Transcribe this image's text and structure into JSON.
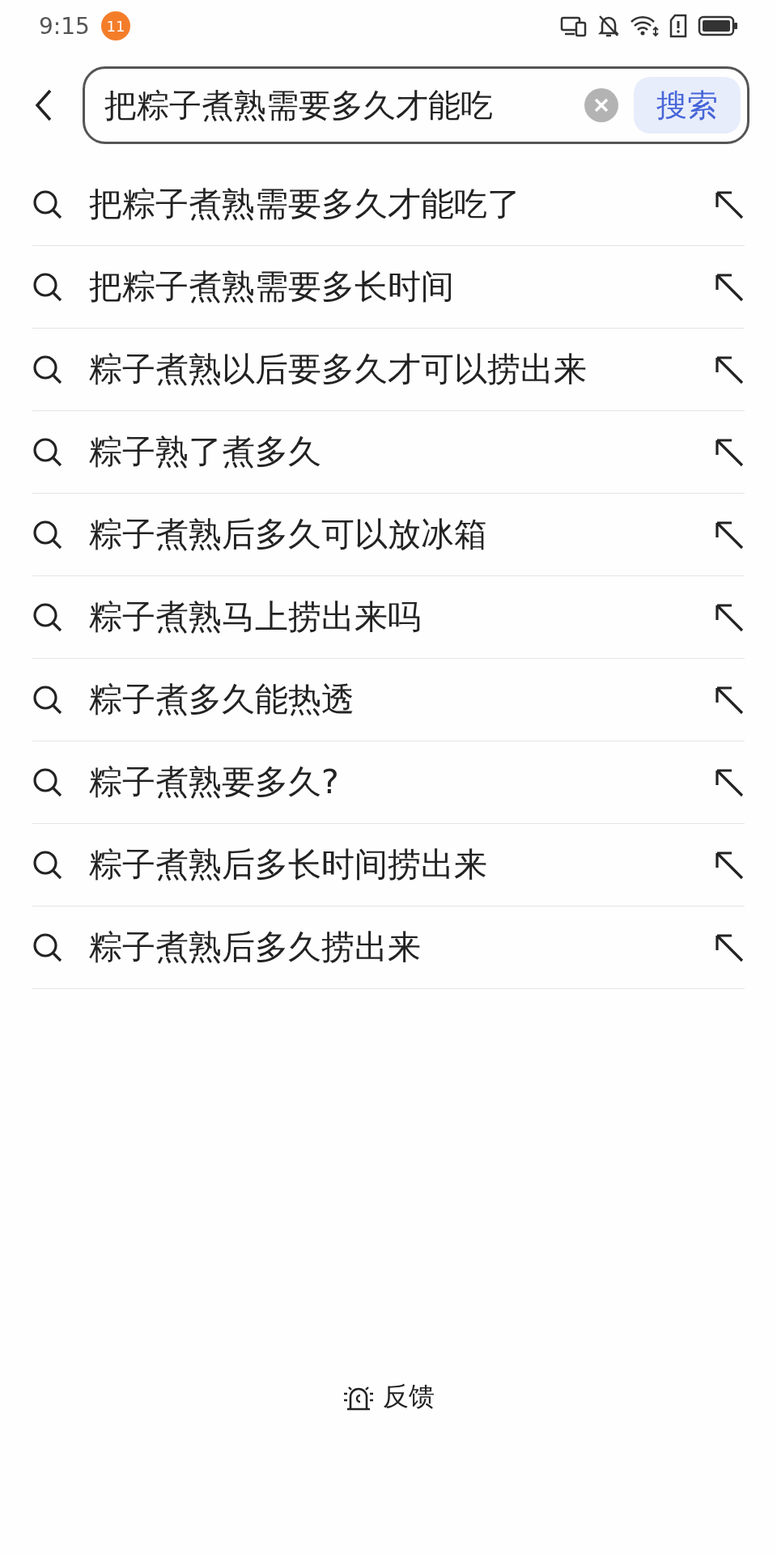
{
  "status_bar": {
    "time": "9:15",
    "notification_count": "11"
  },
  "search": {
    "value": "把粽子煮熟需要多久才能吃",
    "button": "搜索"
  },
  "suggestions": [
    "把粽子煮熟需要多久才能吃了",
    "把粽子煮熟需要多长时间",
    "粽子煮熟以后要多久才可以捞出来",
    "粽子熟了煮多久",
    "粽子煮熟后多久可以放冰箱",
    "粽子煮熟马上捞出来吗",
    "粽子煮多久能热透",
    "粽子煮熟要多久?",
    "粽子煮熟后多长时间捞出来",
    "粽子煮熟后多久捞出来"
  ],
  "feedback": "反馈"
}
